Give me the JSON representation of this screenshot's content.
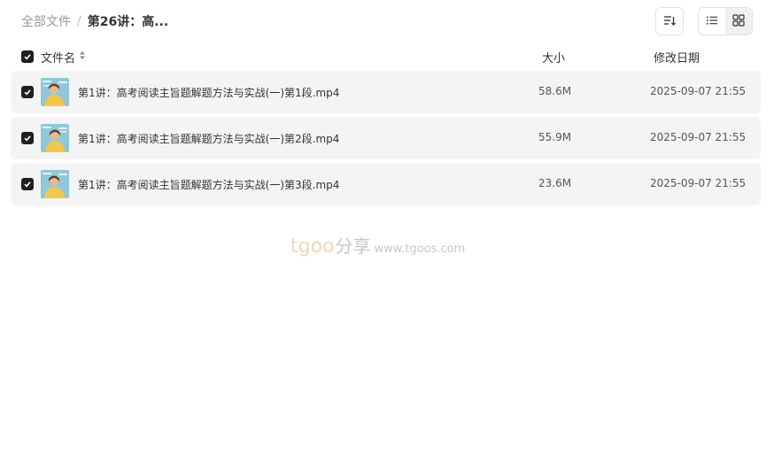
{
  "breadcrumb": {
    "root": "全部文件",
    "separator": "/",
    "current": "第26讲：高..."
  },
  "toolbar": {
    "sort_icon": "sort-icon",
    "list_view_icon": "list-view-icon",
    "grid_view_icon": "grid-view-icon",
    "active_view": "grid"
  },
  "table": {
    "headers": {
      "name": "文件名",
      "size": "大小",
      "date": "修改日期"
    },
    "rows": [
      {
        "name": "第1讲：高考阅读主旨题解题方法与实战(一)第1段.mp4",
        "size": "58.6M",
        "date": "2025-09-07 21:55",
        "checked": true
      },
      {
        "name": "第1讲：高考阅读主旨题解题方法与实战(一)第2段.mp4",
        "size": "55.9M",
        "date": "2025-09-07 21:55",
        "checked": true
      },
      {
        "name": "第1讲：高考阅读主旨题解题方法与实战(一)第3段.mp4",
        "size": "23.6M",
        "date": "2025-09-07 21:55",
        "checked": true
      }
    ]
  },
  "watermark": {
    "brand": "tgoo",
    "brand_cn": "分享",
    "url": "www.tgoos.com"
  },
  "colors": {
    "row_bg": "#f4f4f4",
    "checkbox": "#1f1f1f",
    "watermark_brand": "#e9b978"
  }
}
